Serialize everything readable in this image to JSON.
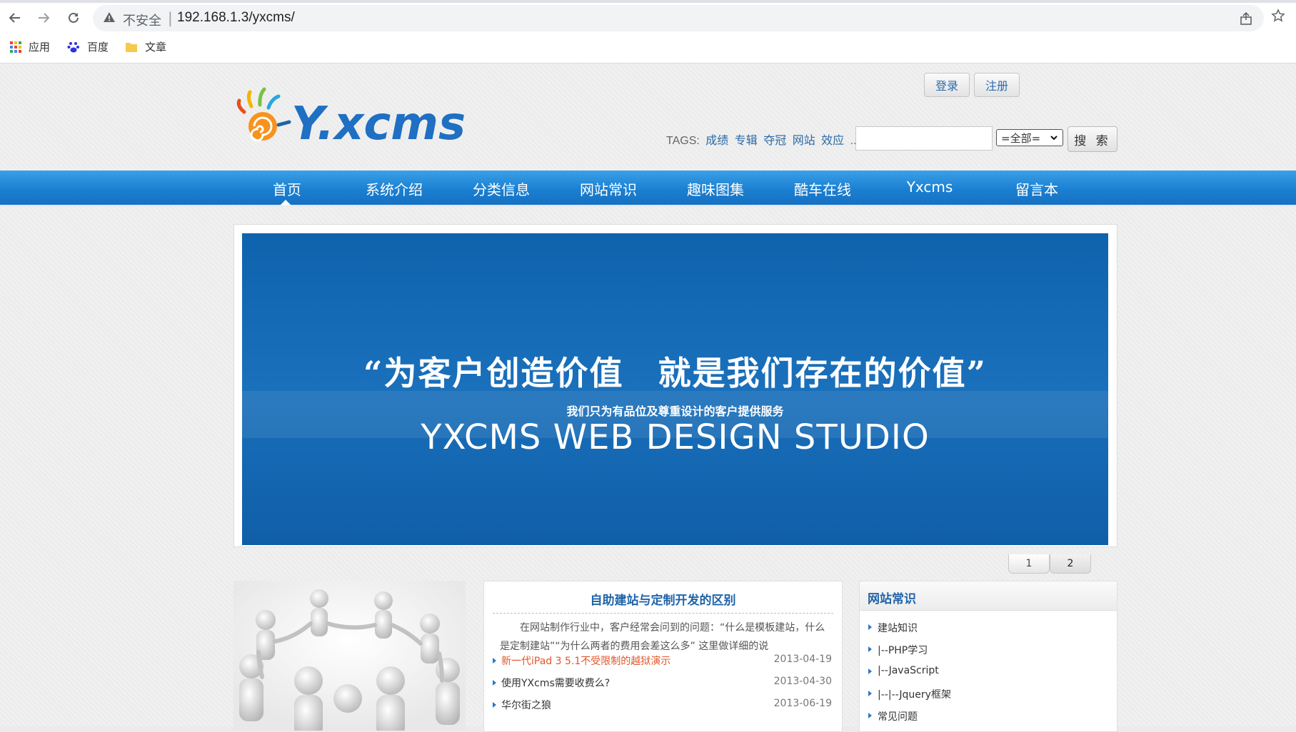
{
  "browser": {
    "insecure_label": "不安全",
    "url": "192.168.1.3/yxcms/",
    "bookmarks": [
      {
        "label": "应用",
        "icon": "apps-grid-icon"
      },
      {
        "label": "百度",
        "icon": "baidu-paw-icon"
      },
      {
        "label": "文章",
        "icon": "folder-icon"
      }
    ]
  },
  "header": {
    "logo_text": "Y.xcms",
    "login_label": "登录",
    "register_label": "注册",
    "tags_label": "TAGS:",
    "tags": [
      "成绩",
      "专辑",
      "夺冠",
      "网站",
      "效应"
    ],
    "tags_more": "...",
    "search_placeholder": "",
    "search_scope": "=全部=",
    "search_button": "搜 索"
  },
  "nav": {
    "items": [
      "首页",
      "系统介绍",
      "分类信息",
      "网站常识",
      "趣味图集",
      "酷车在线",
      "Yxcms",
      "留言本"
    ],
    "active": "首页"
  },
  "banner": {
    "headline": "“为客户创造价值　就是我们存在的价值”",
    "subline": "我们只为有品位及尊重设计的客户提供服务",
    "english": "YXCMS WEB DESIGN STUDIO"
  },
  "pager": {
    "pages": [
      "1",
      "2"
    ],
    "active": "2"
  },
  "news": {
    "title": "自助建站与定制开发的区别",
    "excerpt": "在网站制作行业中，客户经常会问到的问题：“什么是模板建站，什么是定制建站”“为什么两者的费用会差这么多” 这里做详细的说",
    "items": [
      {
        "title": "新一代iPad 3 5.1不受限制的越狱演示",
        "date": "2013-04-19",
        "highlight": true
      },
      {
        "title": "使用YXcms需要收费么?",
        "date": "2013-04-30",
        "highlight": false
      },
      {
        "title": "华尔街之狼",
        "date": "2013-06-19",
        "highlight": false
      }
    ]
  },
  "categories": {
    "title": "网站常识",
    "items": [
      "建站知识",
      "|--PHP学习",
      "|--JavaScript",
      "|--|--Jquery框架",
      "常见问题"
    ]
  },
  "colors": {
    "nav_blue": "#1b80d2",
    "link_blue": "#1f64a8",
    "highlight_orange": "#e2562a",
    "banner_blue": "#1a70bb"
  }
}
